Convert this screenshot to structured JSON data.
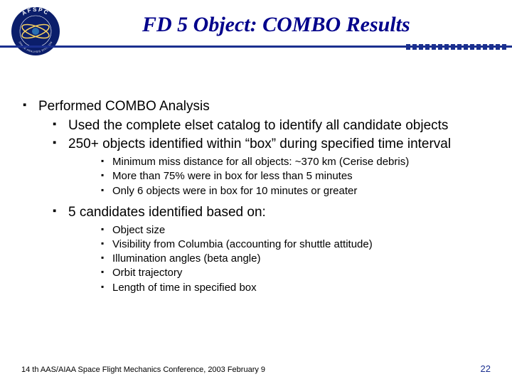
{
  "header": {
    "title": "FD 5 Object: COMBO Results",
    "logo": {
      "outer_text": "AFSPC",
      "inner_text": "SPACE ANALYSIS DIVISION"
    }
  },
  "bullets": {
    "l1_a": "Performed COMBO Analysis",
    "l2_a": "Used the complete elset catalog to identify all candidate objects",
    "l2_b": "250+ objects identified within “box” during specified time interval",
    "l3_a": "Minimum miss distance for all objects: ~370 km (Cerise debris)",
    "l3_b": "More than 75% were in box for less than 5 minutes",
    "l3_c": "Only 6 objects were in box for 10 minutes or greater",
    "l2_c": "5 candidates identified based on:",
    "l3_d": "Object size",
    "l3_e": "Visibility from Columbia (accounting for shuttle attitude)",
    "l3_f": "Illumination angles (beta angle)",
    "l3_g": "Orbit trajectory",
    "l3_h": "Length of time in specified box"
  },
  "footer": {
    "text": "14 th AAS/AIAA Space Flight Mechanics Conference, 2003 February 9",
    "page": "22"
  },
  "colors": {
    "accent": "#1a2f8f"
  }
}
